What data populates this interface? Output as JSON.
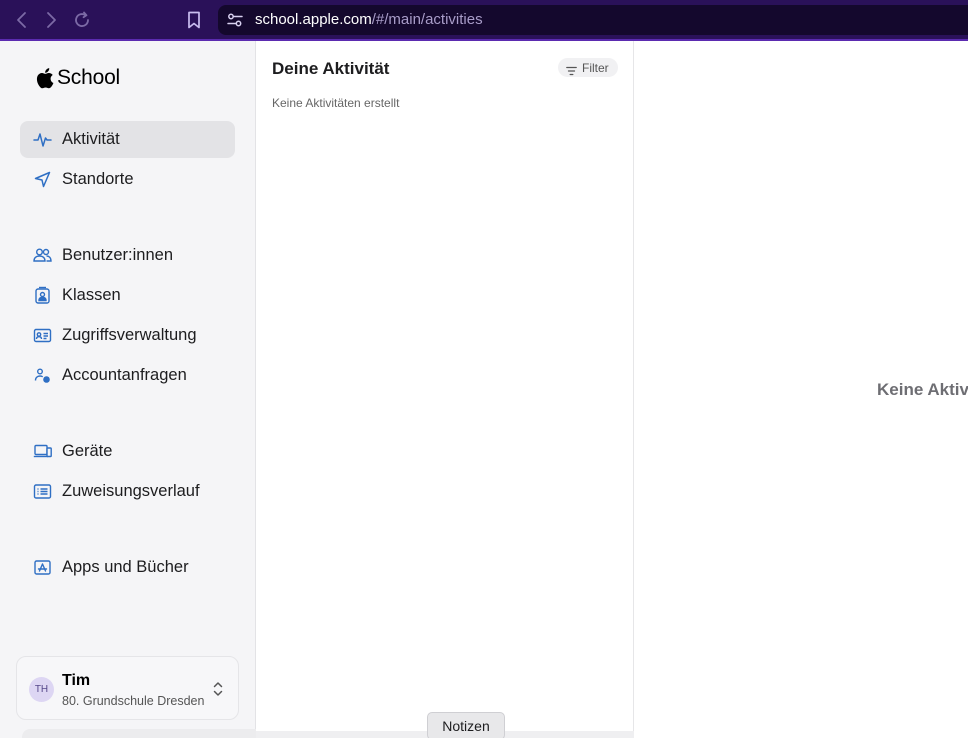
{
  "browser": {
    "url_host": "school.apple.com",
    "url_path": "/#/main/activities"
  },
  "sidebar": {
    "brand": "School",
    "items": [
      {
        "label": "Aktivität",
        "icon": "activity-icon",
        "active": true
      },
      {
        "label": "Standorte",
        "icon": "location-icon"
      },
      {
        "label": "Benutzer:innen",
        "icon": "users-icon"
      },
      {
        "label": "Klassen",
        "icon": "classes-icon"
      },
      {
        "label": "Zugriffsverwaltung",
        "icon": "id-card-icon"
      },
      {
        "label": "Accountanfragen",
        "icon": "account-request-icon"
      },
      {
        "label": "Geräte",
        "icon": "devices-icon"
      },
      {
        "label": "Zuweisungsverlauf",
        "icon": "assignment-history-icon"
      },
      {
        "label": "Apps und Bücher",
        "icon": "apps-icon"
      }
    ],
    "user": {
      "initials": "TH",
      "name": "Tim",
      "school": "80. Grundschule Dresden"
    }
  },
  "activity": {
    "title": "Deine Aktivität",
    "filter_label": "Filter",
    "empty_text": "Keine Aktivitäten erstellt"
  },
  "detail": {
    "empty_text": "Keine Aktivitäten"
  },
  "notes_button": "Notizen",
  "colors": {
    "toolbar": "#2a1159",
    "accent_icon": "#2f6fc4",
    "sidebar_bg": "#f5f5f7"
  }
}
